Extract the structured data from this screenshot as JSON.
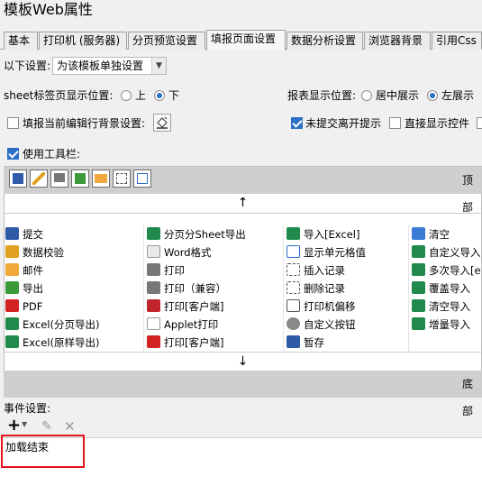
{
  "window": {
    "title": "模板Web属性"
  },
  "tabs": [
    {
      "label": "基本"
    },
    {
      "label": "打印机 (服务器)"
    },
    {
      "label": "分页预览设置"
    },
    {
      "label": "填报页面设置",
      "active": true
    },
    {
      "label": "数据分析设置"
    },
    {
      "label": "浏览器背景"
    },
    {
      "label": "引用Css"
    }
  ],
  "settings": {
    "scope_label": "以下设置:",
    "scope_value": "为该模板单独设置",
    "sheet_position_label": "sheet标签页显示位置:",
    "sheet_options": [
      {
        "label": "上",
        "selected": false
      },
      {
        "label": "下",
        "selected": true
      }
    ],
    "report_position_label": "报表显示位置:",
    "report_options": [
      {
        "label": "居中展示",
        "selected": false
      },
      {
        "label": "左展示",
        "selected": true
      }
    ],
    "highlight_row_label": "填报当前编辑行背景设置:",
    "unsubmitted_label": "未提交离开提示",
    "direct_show_label": "直接显示控件",
    "use_toolbar_label": "使用工具栏:"
  },
  "toolbar": {
    "top_label": "顶部",
    "bottom_label": "底部",
    "up_arrow": "↑",
    "down_arrow": "↓",
    "items_col1": [
      {
        "label": "提交",
        "icon": "save-icon"
      },
      {
        "label": "数据校验",
        "icon": "check-pencil-icon"
      },
      {
        "label": "邮件",
        "icon": "mail-icon"
      },
      {
        "label": "导出",
        "icon": "export-icon"
      },
      {
        "label": "PDF",
        "icon": "pdf-icon"
      },
      {
        "label": "Excel(分页导出)",
        "icon": "excel-icon"
      },
      {
        "label": "Excel(原样导出)",
        "icon": "excel-icon"
      }
    ],
    "items_col2": [
      {
        "label": "分页分Sheet导出",
        "icon": "excel-icon"
      },
      {
        "label": "Word格式",
        "icon": "word-icon"
      },
      {
        "label": "打印",
        "icon": "print-icon"
      },
      {
        "label": "打印（兼容）",
        "icon": "print-icon"
      },
      {
        "label": "打印[客户端]",
        "icon": "flash-print-icon"
      },
      {
        "label": "Applet打印",
        "icon": "applet-icon"
      },
      {
        "label": "打印[客户端]",
        "icon": "pdf-print-icon"
      }
    ],
    "items_col3": [
      {
        "label": "导入[Excel]",
        "icon": "excel-icon"
      },
      {
        "label": "显示单元格值",
        "icon": "cell-icon"
      },
      {
        "label": "插入记录",
        "icon": "insert-row-icon"
      },
      {
        "label": "删除记录",
        "icon": "delete-row-icon"
      },
      {
        "label": "打印机偏移",
        "icon": "move-icon"
      },
      {
        "label": "自定义按钮",
        "icon": "gear-icon"
      },
      {
        "label": "暂存",
        "icon": "save-draft-icon"
      }
    ],
    "items_col4": [
      {
        "label": "清空",
        "icon": "eraser-icon"
      },
      {
        "label": "自定义导入",
        "icon": "excel-icon"
      },
      {
        "label": "多次导入[e",
        "icon": "excel-icon"
      },
      {
        "label": "覆盖导入",
        "icon": "excel-icon"
      },
      {
        "label": "清空导入",
        "icon": "excel-icon"
      },
      {
        "label": "增量导入",
        "icon": "excel-icon"
      }
    ]
  },
  "events": {
    "label": "事件设置:",
    "add_symbol": "+",
    "items": [
      {
        "label": "加载结束"
      }
    ]
  }
}
